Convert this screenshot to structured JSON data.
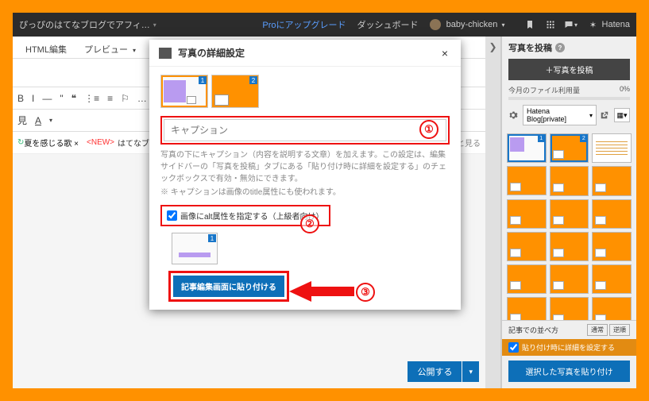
{
  "topbar": {
    "blog_name": "ぴっぴのはてなブログでアフィ…",
    "pro_link": "Proにアップグレード",
    "dashboard": "ダッシュボード",
    "user_name": "baby-chicken",
    "brand": "Hatena"
  },
  "tabs": {
    "html_edit": "HTML編集",
    "preview": "プレビュー"
  },
  "toolbar": {
    "icons": [
      "B",
      "I",
      "—",
      "\"",
      "❝",
      "⋮≡",
      "≡",
      "⚐",
      "…"
    ],
    "row2": [
      "見",
      "A"
    ]
  },
  "retweet": {
    "label_old": "夏を感じる歌 ×",
    "new_tag": "<NEW>",
    "label_new": "はてなブック",
    "more": "もっと見る"
  },
  "publish": {
    "label": "公開する"
  },
  "modal": {
    "title": "写真の詳細設定",
    "thumb1_num": "1",
    "thumb2_num": "2",
    "caption_placeholder": "キャプション",
    "help1": "写真の下にキャプション（内容を説明する文章）を加えます。この設定は、編集サイドバーの「写真を投稿」タブにある「貼り付け時に詳細を設定する」のチェックボックスで有効・無効にできます。",
    "help2": "※ キャプションは画像のtitle属性にも使われます。",
    "alt_label": "画像にalt属性を指定する（上級者向け）",
    "alt_num": "1",
    "insert_label": "記事編集画面に貼り付ける"
  },
  "anno": {
    "n1": "①",
    "n2": "②",
    "n3": "③"
  },
  "sidebar": {
    "title": "写真を投稿",
    "upload": "＋写真を投稿",
    "usage_label": "今月のファイル利用量",
    "usage_pct": "0%",
    "blog_select": "Hatena Blog[private]",
    "grid_numbers": [
      "1",
      "2"
    ],
    "order_label": "記事での並べ方",
    "order_opts": [
      "通常",
      "逆順"
    ],
    "detail_label": "貼り付け時に詳細を設定する",
    "paste_label": "選択した写真を貼り付け"
  }
}
